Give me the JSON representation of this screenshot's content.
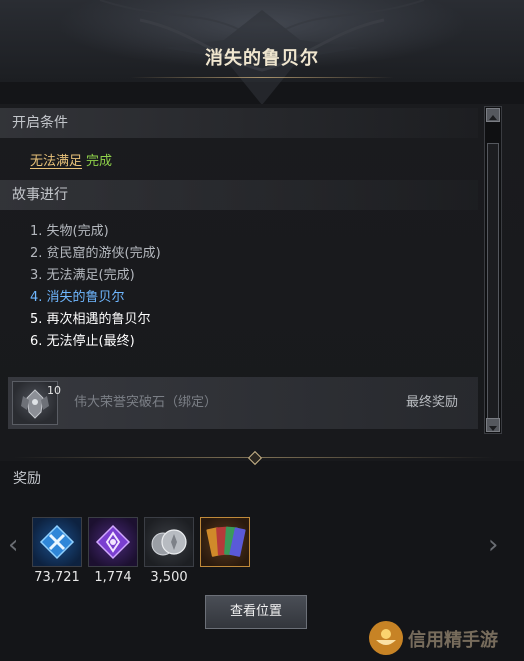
{
  "header": {
    "title": "消失的鲁贝尔"
  },
  "conditions": {
    "label": "开启条件",
    "status_fail": "无法满足",
    "status_ok": "完成"
  },
  "story": {
    "label": "故事进行",
    "steps": [
      {
        "text": "1. 失物(完成)",
        "state": "done"
      },
      {
        "text": "2. 贫民窟的游侠(完成)",
        "state": "done"
      },
      {
        "text": "3. 无法满足(完成)",
        "state": "done"
      },
      {
        "text": "4. 消失的鲁贝尔",
        "state": "current"
      },
      {
        "text": "5. 再次相遇的鲁贝尔",
        "state": "future"
      },
      {
        "text": "6. 无法停止(最终)",
        "state": "future"
      }
    ]
  },
  "final_reward": {
    "count": "10",
    "name": "伟大荣誉突破石（绑定）",
    "tag": "最终奖励",
    "icon": "gem-crest-icon"
  },
  "rewards": {
    "label": "奖励",
    "items": [
      {
        "icon": "blue-crossed-swords-icon",
        "value": "73,721"
      },
      {
        "icon": "purple-sigil-icon",
        "value": "1,774"
      },
      {
        "icon": "silver-coins-icon",
        "value": "3,500"
      },
      {
        "icon": "card-bundle-icon",
        "value": ""
      }
    ]
  },
  "button": {
    "label": "查看位置"
  },
  "watermark": {
    "text": "信用精手游"
  },
  "colors": {
    "accent_blue": "#6fb7ff",
    "complete_green": "#8fd14a",
    "warning_gold": "#e8c27a"
  }
}
